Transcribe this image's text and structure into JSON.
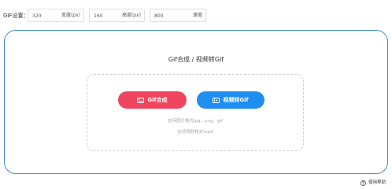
{
  "settings": {
    "label": "GIF设置：",
    "width": {
      "value": "320",
      "suffix": "宽度(px)"
    },
    "height": {
      "value": "160",
      "suffix": "高度(px)"
    },
    "speed": {
      "value": "800",
      "suffix": "速度"
    }
  },
  "main": {
    "title": "Gif合成 / 视频转Gif",
    "buttons": {
      "gif_compose": {
        "label": "Gif合成",
        "icon": "image-icon",
        "color": "#f0455f"
      },
      "video_to_gif": {
        "label": "视频转Gif",
        "icon": "video-icon",
        "color": "#1f8ef0"
      }
    },
    "hints": {
      "images": "支持图片格式jpg、png、gif",
      "video": "支持视频格式mp4"
    }
  },
  "help": {
    "label": "使用帮助",
    "icon": "help-circle-icon"
  },
  "colors": {
    "accent_border": "#3f88d6",
    "red_button": "#f0455f",
    "blue_button": "#1f8ef0"
  }
}
